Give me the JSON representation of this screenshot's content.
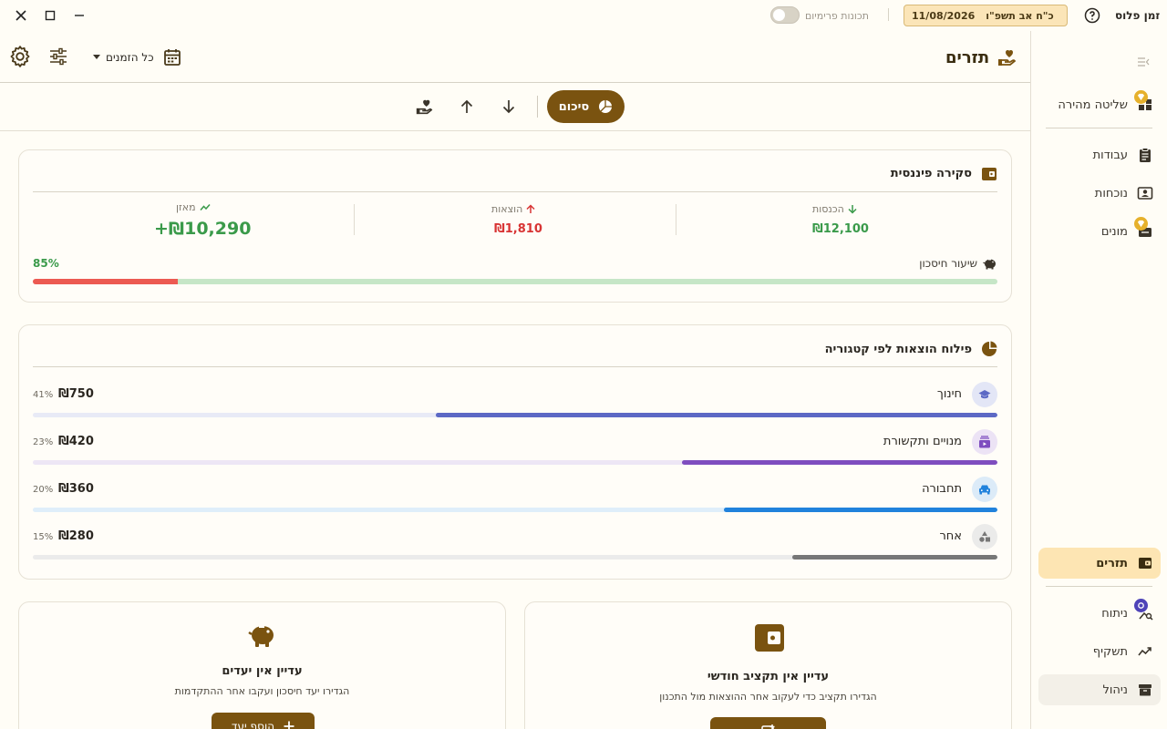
{
  "app": {
    "name": "זמן פלוס"
  },
  "titlebar": {
    "date_gregorian": "11/08/2026",
    "date_hebrew": "כ\"ח אב תשפ\"ו",
    "premium_label": "תכונות פרימיום",
    "premium_enabled": false
  },
  "sidebar": {
    "items": [
      {
        "label": "שליטה מהירה",
        "icon": "quick-control-icon",
        "badge": "premium"
      },
      {
        "label": "עבודות",
        "icon": "clipboard-icon"
      },
      {
        "label": "נוכחות",
        "icon": "attendance-icon"
      },
      {
        "label": "מונים",
        "icon": "counters-icon",
        "badge": "premium"
      },
      {
        "label": "תזרים",
        "icon": "wallet-icon",
        "active": true
      },
      {
        "label": "ניתוח",
        "icon": "analysis-icon",
        "badge": "ai"
      },
      {
        "label": "תשקיף",
        "icon": "trend-icon"
      },
      {
        "label": "ניהול",
        "icon": "archive-icon"
      }
    ]
  },
  "header": {
    "title": "תזרים",
    "period_label": "כל הזמנים"
  },
  "tabs": {
    "summary_label": "סיכום"
  },
  "overview": {
    "title": "סקירה פיננסית",
    "income": {
      "label": "הכנסות",
      "value": "₪12,100"
    },
    "expenses": {
      "label": "הוצאות",
      "value": "₪1,810"
    },
    "balance": {
      "label": "מאזן",
      "value": "+₪10,290"
    },
    "savings": {
      "label": "שיעור חיסכון",
      "percent_text": "85%",
      "rate": 0.85
    },
    "colors": {
      "income": "#3a9a4a",
      "expense": "#d83434",
      "savings_track": "#c6e6c7",
      "savings_remainder": "#ec5a52"
    }
  },
  "categories": {
    "title": "פילוח הוצאות לפי קטגוריה",
    "items": [
      {
        "label": "חינוך",
        "amount": "₪750",
        "percent_text": "41%",
        "share": 0.41,
        "color": "#5c69c5",
        "track": "#e8eaf6",
        "icon_bg": "#e3e6f6",
        "icon": "graduation-cap-icon"
      },
      {
        "label": "מנויים ותקשורת",
        "amount": "₪420",
        "percent_text": "23%",
        "share": 0.23,
        "color": "#7e4dbf",
        "track": "#ede6f5",
        "icon_bg": "#ece3f5",
        "icon": "subscriptions-icon"
      },
      {
        "label": "תחבורה",
        "amount": "₪360",
        "percent_text": "20%",
        "share": 0.2,
        "color": "#2182dc",
        "track": "#dfeefa",
        "icon_bg": "#dcebf8",
        "icon": "car-icon"
      },
      {
        "label": "אחר",
        "amount": "₪280",
        "percent_text": "15%",
        "share": 0.15,
        "color": "#777777",
        "track": "#ebebeb",
        "icon_bg": "#ebebea",
        "icon": "shapes-icon"
      }
    ]
  },
  "budget_empty": {
    "title": "עדיין אין תקציב חודשי",
    "subtitle": "הגדירו תקציב כדי לעקוב אחר ההוצאות מול התכנון"
  },
  "goals_empty": {
    "title": "עדיין אין יעדים",
    "subtitle": "הגדירו יעד חיסכון ועקבו אחר ההתקדמות",
    "button_label": "הוסף יעד"
  },
  "accent": "#7a5310"
}
